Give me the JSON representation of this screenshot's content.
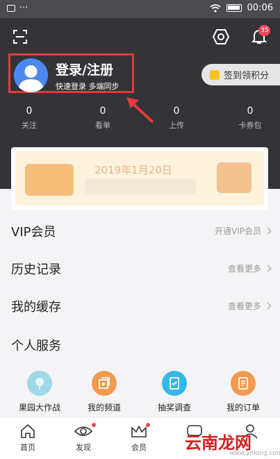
{
  "status_bar": {
    "time": "00:06",
    "dots": "···"
  },
  "header": {
    "notification_count": "35",
    "login_title": "登录/注册",
    "login_subtitle": "快速登录 多端同步",
    "checkin_label": "签到领积分"
  },
  "stats": [
    {
      "value": "0",
      "label": "关注"
    },
    {
      "value": "0",
      "label": "看单"
    },
    {
      "value": "0",
      "label": "上传"
    },
    {
      "value": "0",
      "label": "卡券包"
    }
  ],
  "banner": {
    "text": "2019年1月20日"
  },
  "menu": [
    {
      "title": "VIP会员",
      "right": "开通VIP会员"
    },
    {
      "title": "历史记录",
      "right": "查看更多"
    },
    {
      "title": "我的缓存",
      "right": "查看更多"
    },
    {
      "title": "个人服务",
      "right": ""
    }
  ],
  "services": [
    {
      "label": "果园大作战",
      "icon": "orchard-icon",
      "color": "#9fd8e6"
    },
    {
      "label": "我的频道",
      "icon": "channel-icon",
      "color": "#f29a4e"
    },
    {
      "label": "抽奖调查",
      "icon": "survey-icon",
      "color": "#36b6ea"
    },
    {
      "label": "我的订单",
      "icon": "order-icon",
      "color": "#f29a4e"
    }
  ],
  "tabs": [
    {
      "label": "首页",
      "icon": "home-icon"
    },
    {
      "label": "发现",
      "icon": "eye-icon"
    },
    {
      "label": "会员",
      "icon": "crown-icon"
    },
    {
      "label": "",
      "icon": "chat-icon"
    },
    {
      "label": "",
      "icon": "user-icon"
    }
  ],
  "watermark": {
    "text": "云南龙网",
    "url": "www.ynlong.com"
  },
  "colors": {
    "header_bg": "#333338",
    "accent_red": "#e33b3b",
    "badge": "#f0465a"
  }
}
